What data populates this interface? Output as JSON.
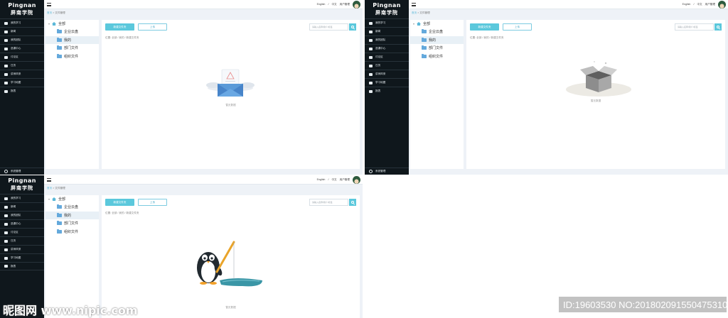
{
  "app": {
    "logo_en": "Pingnan",
    "logo_cn": "屏南学院"
  },
  "sidebar": {
    "items": [
      {
        "label": "我的学习"
      },
      {
        "label": "新闻"
      },
      {
        "label": "我的团队"
      },
      {
        "label": "选课中心"
      },
      {
        "label": "讨论区"
      },
      {
        "label": "日历"
      },
      {
        "label": "讲师风采"
      },
      {
        "label": "学习地图"
      },
      {
        "label": "报表"
      }
    ],
    "bottom_label": "系统管理"
  },
  "topbar": {
    "lang_en": "English",
    "separator": "/",
    "lang_cn": "中文",
    "user_manage": "用户管理"
  },
  "breadcrumb": {
    "home": "首页",
    "arrow": ">",
    "current": "文件管理"
  },
  "tree": {
    "chevron": "▾",
    "root": "全部",
    "items": [
      {
        "label": "企业云盘"
      },
      {
        "label": "我的",
        "active": true
      },
      {
        "label": "部门文件"
      },
      {
        "label": "组织文件"
      }
    ]
  },
  "toolbar": {
    "new_folder": "新建文件夹",
    "upload": "上传",
    "search_placeholder": "请输入名称/简介/标签"
  },
  "main": {
    "path": "位置: 全部 / 我的 / 新建文件夹",
    "empty_text": "暂无数据"
  },
  "watermark": {
    "logo": "昵图网 www.nipic.com",
    "id_text": "ID:19603530 NO:20180209155047531000"
  },
  "colors": {
    "sidebar_bg": "#0f171c",
    "accent": "#5bc8dc",
    "panel_bg": "#eef2f7"
  },
  "icons": {
    "empty_states": [
      "envelope-illustration",
      "box-illustration",
      "penguin-fishing-illustration"
    ]
  }
}
